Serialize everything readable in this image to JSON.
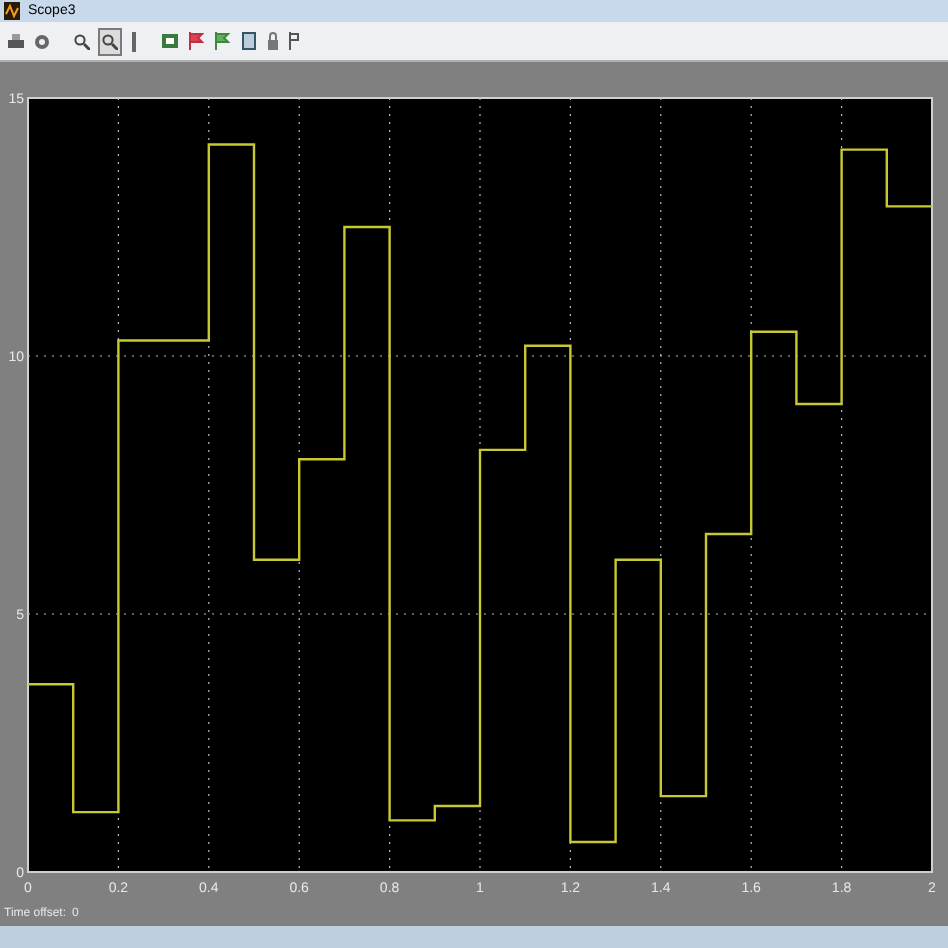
{
  "window": {
    "title": "Scope3"
  },
  "plot": {
    "chart_data": {
      "type": "line",
      "xlim": [
        0,
        2
      ],
      "ylim": [
        0,
        15
      ],
      "xticks": [
        {
          "value": 0,
          "label": "0"
        },
        {
          "value": 0.2,
          "label": "0.2"
        },
        {
          "value": 0.4,
          "label": "0.4"
        },
        {
          "value": 0.6,
          "label": "0.6"
        },
        {
          "value": 0.8,
          "label": "0.8"
        },
        {
          "value": 1,
          "label": "1"
        },
        {
          "value": 1.2,
          "label": "1.2"
        },
        {
          "value": 1.4,
          "label": "1.4"
        },
        {
          "value": 1.6,
          "label": "1.6"
        },
        {
          "value": 1.8,
          "label": "1.8"
        },
        {
          "value": 2,
          "label": "2"
        }
      ],
      "yticks": [
        {
          "value": 0,
          "label": "0"
        },
        {
          "value": 5,
          "label": "5"
        },
        {
          "value": 10,
          "label": "10"
        },
        {
          "value": 15,
          "label": "15"
        }
      ],
      "grid": true,
      "x": [
        0,
        0.1,
        0.1,
        0.2,
        0.2,
        0.4,
        0.4,
        0.5,
        0.5,
        0.6,
        0.6,
        0.7,
        0.7,
        0.8,
        0.8,
        0.9,
        0.9,
        1.0,
        1.0,
        1.1,
        1.1,
        1.2,
        1.2,
        1.3,
        1.3,
        1.4,
        1.4,
        1.5,
        1.5,
        1.6,
        1.6,
        1.7,
        1.7,
        1.8,
        1.8,
        1.9,
        1.9,
        2.0
      ],
      "series": [
        {
          "color": "#c8c832",
          "values": [
            3.64,
            3.64,
            1.16,
            1.16,
            10.3,
            10.3,
            14.1,
            14.1,
            6.05,
            6.05,
            8.0,
            8.0,
            12.5,
            12.5,
            1.0,
            1.0,
            1.28,
            1.28,
            8.18,
            8.18,
            10.2,
            10.2,
            0.58,
            0.58,
            6.05,
            6.05,
            1.47,
            1.47,
            6.55,
            6.55,
            10.47,
            10.47,
            9.07,
            9.07,
            14.0,
            14.0,
            12.9,
            12.9
          ]
        }
      ]
    }
  },
  "status": {
    "label": "Time offset:",
    "value": "0"
  }
}
